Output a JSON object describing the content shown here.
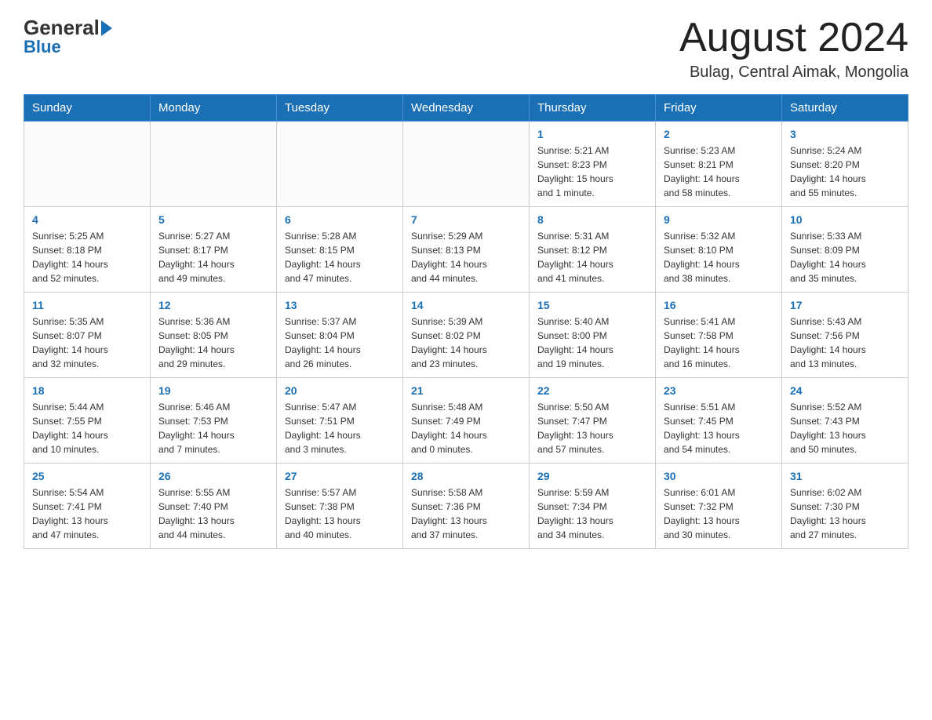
{
  "header": {
    "logo_general": "General",
    "logo_blue": "Blue",
    "month_title": "August 2024",
    "location": "Bulag, Central Aimak, Mongolia"
  },
  "weekdays": [
    "Sunday",
    "Monday",
    "Tuesday",
    "Wednesday",
    "Thursday",
    "Friday",
    "Saturday"
  ],
  "weeks": [
    [
      {
        "day": "",
        "info": ""
      },
      {
        "day": "",
        "info": ""
      },
      {
        "day": "",
        "info": ""
      },
      {
        "day": "",
        "info": ""
      },
      {
        "day": "1",
        "info": "Sunrise: 5:21 AM\nSunset: 8:23 PM\nDaylight: 15 hours\nand 1 minute."
      },
      {
        "day": "2",
        "info": "Sunrise: 5:23 AM\nSunset: 8:21 PM\nDaylight: 14 hours\nand 58 minutes."
      },
      {
        "day": "3",
        "info": "Sunrise: 5:24 AM\nSunset: 8:20 PM\nDaylight: 14 hours\nand 55 minutes."
      }
    ],
    [
      {
        "day": "4",
        "info": "Sunrise: 5:25 AM\nSunset: 8:18 PM\nDaylight: 14 hours\nand 52 minutes."
      },
      {
        "day": "5",
        "info": "Sunrise: 5:27 AM\nSunset: 8:17 PM\nDaylight: 14 hours\nand 49 minutes."
      },
      {
        "day": "6",
        "info": "Sunrise: 5:28 AM\nSunset: 8:15 PM\nDaylight: 14 hours\nand 47 minutes."
      },
      {
        "day": "7",
        "info": "Sunrise: 5:29 AM\nSunset: 8:13 PM\nDaylight: 14 hours\nand 44 minutes."
      },
      {
        "day": "8",
        "info": "Sunrise: 5:31 AM\nSunset: 8:12 PM\nDaylight: 14 hours\nand 41 minutes."
      },
      {
        "day": "9",
        "info": "Sunrise: 5:32 AM\nSunset: 8:10 PM\nDaylight: 14 hours\nand 38 minutes."
      },
      {
        "day": "10",
        "info": "Sunrise: 5:33 AM\nSunset: 8:09 PM\nDaylight: 14 hours\nand 35 minutes."
      }
    ],
    [
      {
        "day": "11",
        "info": "Sunrise: 5:35 AM\nSunset: 8:07 PM\nDaylight: 14 hours\nand 32 minutes."
      },
      {
        "day": "12",
        "info": "Sunrise: 5:36 AM\nSunset: 8:05 PM\nDaylight: 14 hours\nand 29 minutes."
      },
      {
        "day": "13",
        "info": "Sunrise: 5:37 AM\nSunset: 8:04 PM\nDaylight: 14 hours\nand 26 minutes."
      },
      {
        "day": "14",
        "info": "Sunrise: 5:39 AM\nSunset: 8:02 PM\nDaylight: 14 hours\nand 23 minutes."
      },
      {
        "day": "15",
        "info": "Sunrise: 5:40 AM\nSunset: 8:00 PM\nDaylight: 14 hours\nand 19 minutes."
      },
      {
        "day": "16",
        "info": "Sunrise: 5:41 AM\nSunset: 7:58 PM\nDaylight: 14 hours\nand 16 minutes."
      },
      {
        "day": "17",
        "info": "Sunrise: 5:43 AM\nSunset: 7:56 PM\nDaylight: 14 hours\nand 13 minutes."
      }
    ],
    [
      {
        "day": "18",
        "info": "Sunrise: 5:44 AM\nSunset: 7:55 PM\nDaylight: 14 hours\nand 10 minutes."
      },
      {
        "day": "19",
        "info": "Sunrise: 5:46 AM\nSunset: 7:53 PM\nDaylight: 14 hours\nand 7 minutes."
      },
      {
        "day": "20",
        "info": "Sunrise: 5:47 AM\nSunset: 7:51 PM\nDaylight: 14 hours\nand 3 minutes."
      },
      {
        "day": "21",
        "info": "Sunrise: 5:48 AM\nSunset: 7:49 PM\nDaylight: 14 hours\nand 0 minutes."
      },
      {
        "day": "22",
        "info": "Sunrise: 5:50 AM\nSunset: 7:47 PM\nDaylight: 13 hours\nand 57 minutes."
      },
      {
        "day": "23",
        "info": "Sunrise: 5:51 AM\nSunset: 7:45 PM\nDaylight: 13 hours\nand 54 minutes."
      },
      {
        "day": "24",
        "info": "Sunrise: 5:52 AM\nSunset: 7:43 PM\nDaylight: 13 hours\nand 50 minutes."
      }
    ],
    [
      {
        "day": "25",
        "info": "Sunrise: 5:54 AM\nSunset: 7:41 PM\nDaylight: 13 hours\nand 47 minutes."
      },
      {
        "day": "26",
        "info": "Sunrise: 5:55 AM\nSunset: 7:40 PM\nDaylight: 13 hours\nand 44 minutes."
      },
      {
        "day": "27",
        "info": "Sunrise: 5:57 AM\nSunset: 7:38 PM\nDaylight: 13 hours\nand 40 minutes."
      },
      {
        "day": "28",
        "info": "Sunrise: 5:58 AM\nSunset: 7:36 PM\nDaylight: 13 hours\nand 37 minutes."
      },
      {
        "day": "29",
        "info": "Sunrise: 5:59 AM\nSunset: 7:34 PM\nDaylight: 13 hours\nand 34 minutes."
      },
      {
        "day": "30",
        "info": "Sunrise: 6:01 AM\nSunset: 7:32 PM\nDaylight: 13 hours\nand 30 minutes."
      },
      {
        "day": "31",
        "info": "Sunrise: 6:02 AM\nSunset: 7:30 PM\nDaylight: 13 hours\nand 27 minutes."
      }
    ]
  ]
}
